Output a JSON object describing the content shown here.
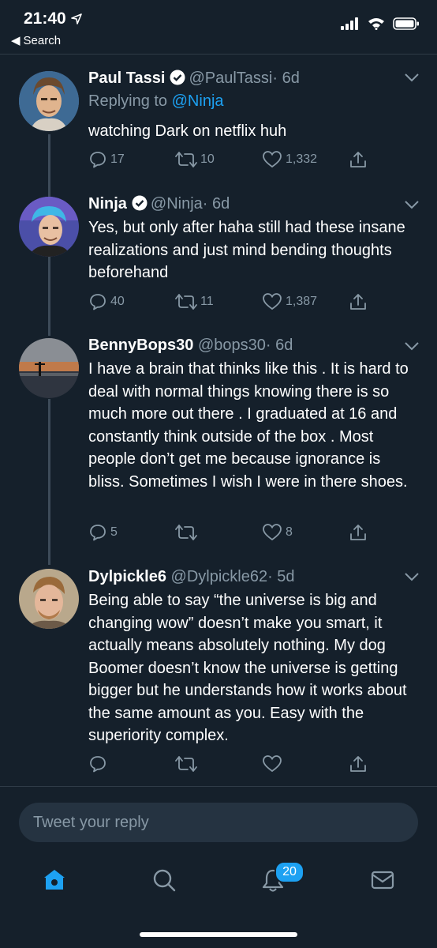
{
  "status_bar": {
    "time": "21:40",
    "back_label": "Search"
  },
  "tweets": [
    {
      "name": "Paul Tassi",
      "handle": "@PaulTassi",
      "time": "· 6d",
      "verified": true,
      "replying_prefix": "Replying to",
      "replying_to": "@Ninja",
      "body": "watching Dark on netflix huh",
      "replies": "17",
      "retweets": "10",
      "likes": "1,332"
    },
    {
      "name": "Ninja",
      "handle": "@Ninja",
      "time": "· 6d",
      "verified": true,
      "body": "Yes, but only after haha still had these insane realizations and just mind bending thoughts beforehand",
      "replies": "40",
      "retweets": "11",
      "likes": "1,387"
    },
    {
      "name": "BennyBops30",
      "handle": "@bops30",
      "time": "· 6d",
      "verified": false,
      "body": "I have a brain that thinks like this . It is hard to deal with normal things knowing there is so much more out there . I graduated at 16 and constantly think outside of the box . Most people don’t get me because ignorance is bliss. Sometimes I wish I were in there shoes.",
      "replies": "5",
      "retweets": "",
      "likes": "8"
    },
    {
      "name": "Dylpickle6",
      "handle": "@Dylpickle62",
      "time": "· 5d",
      "verified": false,
      "body": "Being able to say “the universe is big and changing wow” doesn’t make you smart, it actually means absolutely nothing. My dog Boomer doesn’t know the universe is getting bigger but he understands how it works about the same amount as you. Easy with the superiority complex.",
      "replies": "",
      "retweets": "",
      "likes": ""
    }
  ],
  "reply_box": {
    "placeholder": "Tweet your reply"
  },
  "tab_bar": {
    "notifications_badge": "20"
  },
  "colors": {
    "background": "#15202b",
    "accent": "#1da1f2",
    "muted": "#8899a6"
  }
}
